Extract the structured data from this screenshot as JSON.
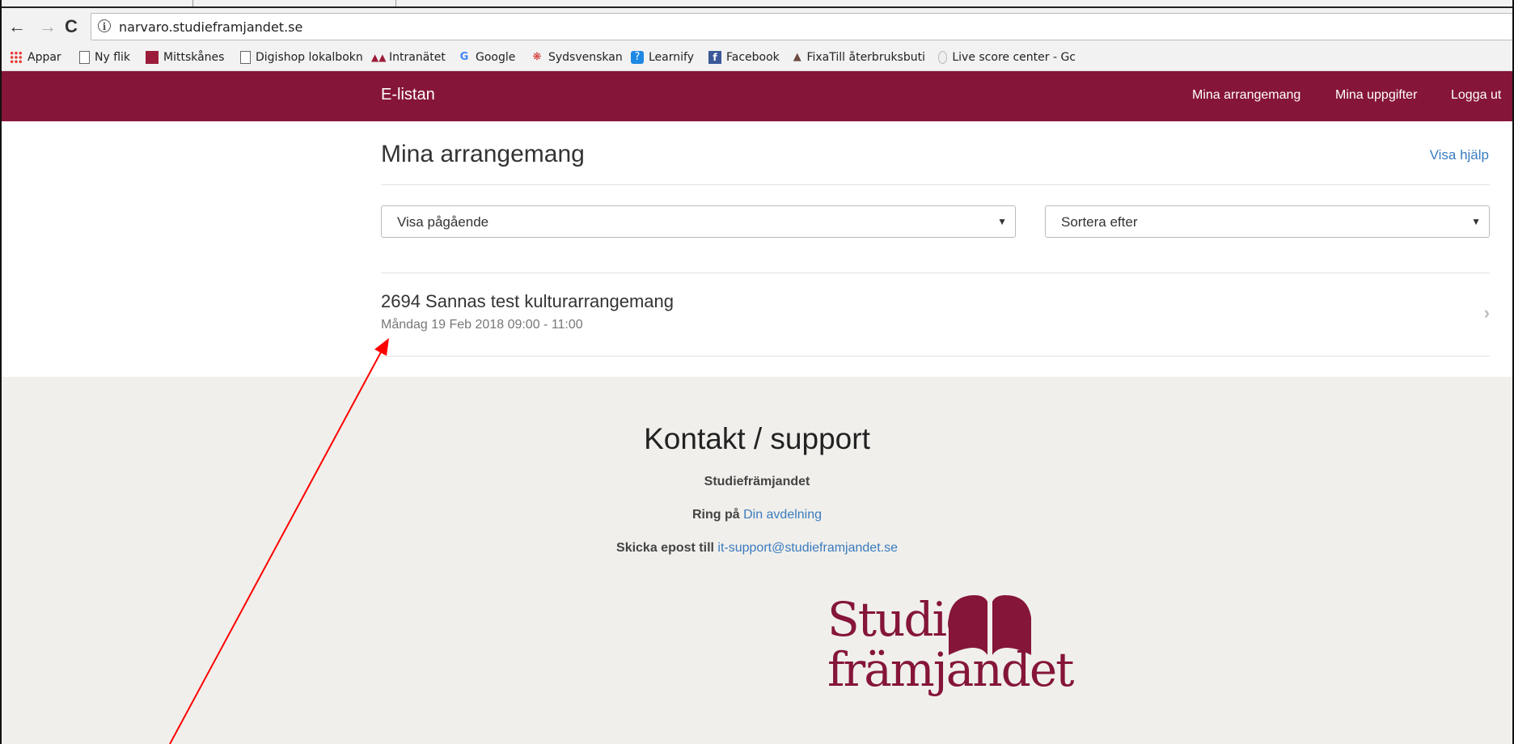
{
  "browser": {
    "url": "narvaro.studieframjandet.se",
    "bookmarks": [
      {
        "label": "Appar",
        "icon": "apps-grid-icon"
      },
      {
        "label": "Ny flik",
        "icon": "page-icon"
      },
      {
        "label": "Mittskånes",
        "icon": "mittskanes-icon"
      },
      {
        "label": "Digishop lokalbokn",
        "icon": "page-icon"
      },
      {
        "label": "Intranätet",
        "icon": "intranet-icon"
      },
      {
        "label": "Google",
        "icon": "google-icon"
      },
      {
        "label": "Sydsvenskan",
        "icon": "sydsvenskan-icon"
      },
      {
        "label": "Learnify",
        "icon": "learnify-icon"
      },
      {
        "label": "Facebook",
        "icon": "facebook-icon"
      },
      {
        "label": "FixaTill återbruksbuti",
        "icon": "fixatill-icon"
      },
      {
        "label": "Live score center - Gc",
        "icon": "live-score-icon"
      }
    ]
  },
  "header": {
    "brand": "E-listan",
    "nav": {
      "events": "Mina arrangemang",
      "profile": "Mina uppgifter",
      "logout": "Logga ut"
    },
    "color": "#851539"
  },
  "main": {
    "title": "Mina arrangemang",
    "help_link": "Visa hjälp",
    "filter_select": "Visa pågående",
    "sort_select": "Sortera efter",
    "events": [
      {
        "title": "2694 Sannas test kulturarrangemang",
        "date": "Måndag 19 Feb 2018 09:00 - 11:00"
      }
    ]
  },
  "footer": {
    "title": "Kontakt / support",
    "org": "Studiefrämjandet",
    "call_prefix": "Ring på",
    "call_link": "Din avdelning",
    "email_prefix": "Skicka epost till",
    "email_link": "it-support@studieframjandet.se",
    "logo_line1": "Studie",
    "logo_line2": "främjandet",
    "background": "#f0efeb"
  },
  "annotation": {
    "color": "#ff0000",
    "type": "arrow"
  }
}
